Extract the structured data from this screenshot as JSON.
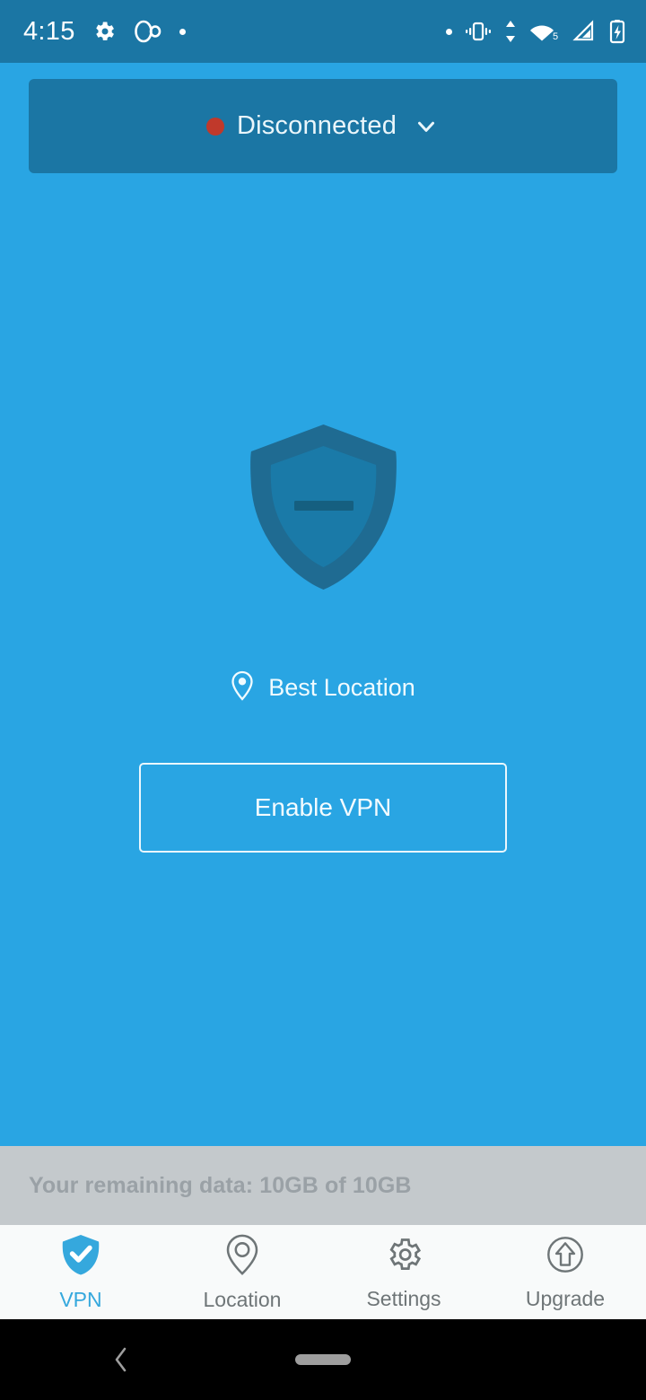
{
  "status_bar": {
    "clock": "4:15",
    "left_icons": [
      "gear-icon",
      "dual-circle-icon",
      "dot-icon"
    ],
    "right_icons": [
      "dot-icon",
      "vibrate-icon",
      "data-transfer-icon",
      "wifi-icon",
      "cell-signal-icon",
      "battery-charging-icon"
    ],
    "wifi_badge": "5",
    "background_color": "#1b76a4"
  },
  "status_card": {
    "indicator": "red-dot",
    "indicator_color": "#c0392b",
    "label": "Disconnected",
    "chevron": "chevron-down-icon",
    "background_color": "#1b76a4"
  },
  "main": {
    "shield": {
      "icon": "shield-minus-icon",
      "outer_color": "#1f6b92",
      "inner_color": "#1a7aa8",
      "dash_color": "#155f80"
    },
    "location": {
      "icon": "map-pin-icon",
      "label": "Best Location"
    },
    "enable_button": {
      "label": "Enable VPN",
      "border_color": "#eaf7fd"
    },
    "background_color": "#29a5e3"
  },
  "data_banner": {
    "text": "Your remaining data: 10GB of 10GB",
    "background_color": "#c4c9cc",
    "text_color": "#9aa1a6"
  },
  "tabbar": {
    "active_color": "#35a8dd",
    "inactive_color": "#6e7577",
    "items": [
      {
        "label": "VPN",
        "icon": "shield-check-icon",
        "active": true
      },
      {
        "label": "Location",
        "icon": "map-pin-icon",
        "active": false
      },
      {
        "label": "Settings",
        "icon": "gear-icon",
        "active": false
      },
      {
        "label": "Upgrade",
        "icon": "arrow-up-circle-icon",
        "active": false
      }
    ]
  },
  "android_nav": {
    "back": "back-chevron-icon",
    "home": "home-pill-handle"
  }
}
